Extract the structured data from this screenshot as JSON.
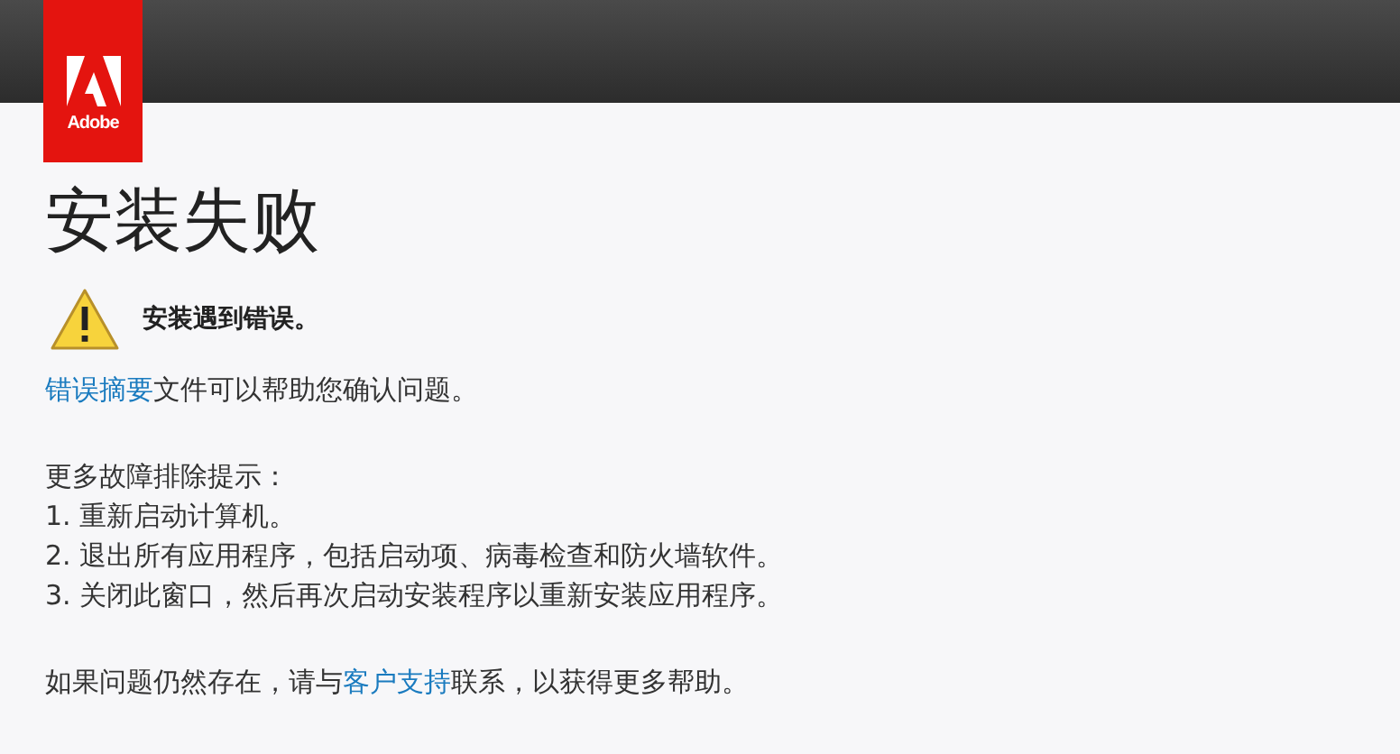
{
  "logo": {
    "text": "Adobe"
  },
  "title": "安装失败",
  "alert": {
    "kind": "warning",
    "text": "安装遇到错误。"
  },
  "summary": [
    {
      "text": "错误摘要",
      "link": true
    },
    {
      "text": "文件可以帮助您确认问题。",
      "link": false
    }
  ],
  "tips": {
    "heading": "更多故障排除提示：",
    "items": [
      "1. 重新启动计算机。",
      "2. 退出所有应用程序，包括启动项、病毒检查和防火墙软件。",
      "3. 关闭此窗口，然后再次启动安装程序以重新安装应用程序。"
    ]
  },
  "footer": [
    {
      "text": "如果问题仍然存在，请与",
      "link": false
    },
    {
      "text": "客户支持",
      "link": true
    },
    {
      "text": "联系，以获得更多帮助。",
      "link": false
    }
  ]
}
